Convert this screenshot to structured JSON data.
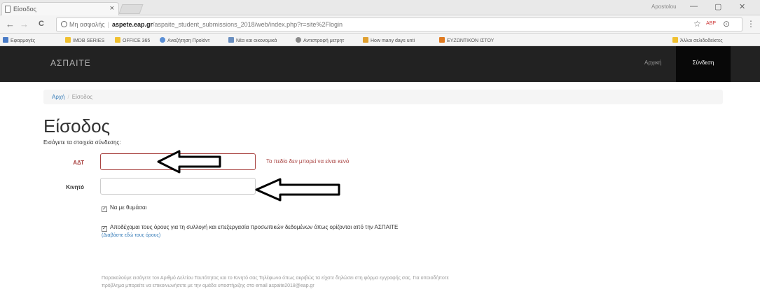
{
  "browser": {
    "tab_title": "Είσοδος",
    "tab_close": "×",
    "profile_name": "Apostolou",
    "window_controls": [
      "—",
      "▢",
      "✕"
    ],
    "nav": {
      "back": "←",
      "forward": "→",
      "reload": "C"
    },
    "address": {
      "security_label": "Μη ασφαλής",
      "host": "aspete.eap.gr",
      "path": "/aspaite_student_submissions_2018/web/index.php?r=site%2Flogin"
    },
    "toolbar_right": [
      "☆",
      "ABP",
      "⊙",
      "⋮"
    ],
    "bookmarks": [
      {
        "label": "Εφαρμογές",
        "color": "#4a7cc7"
      },
      {
        "label": "IMDB SERIES",
        "color": "#f0c030"
      },
      {
        "label": "OFFICE 365",
        "color": "#f0c030"
      },
      {
        "label": "Αναζήτηση Προϊόντ",
        "color": "#5b8fd6"
      },
      {
        "label": "Νέα και οικονομικά",
        "color": "#6a8fc0"
      },
      {
        "label": "Αντιστροφή μετρητ",
        "color": "#8a8a8a"
      },
      {
        "label": "How many days unti",
        "color": "#e0a030"
      },
      {
        "label": "ΕΥΖΩΝΤΙΚΟΝ ΙΣΤΟΥ",
        "color": "#e07a20"
      }
    ],
    "other_bookmarks": "Άλλοι σελιδοδείκτες"
  },
  "site": {
    "brand": "ΑΣΠΑΙΤΕ",
    "nav_home": "Αρχική",
    "nav_login": "Σύνδεση"
  },
  "breadcrumb": {
    "home": "Αρχή",
    "divider": "/",
    "current": "Είσοδος"
  },
  "page": {
    "title": "Είσοδος",
    "intro": "Εισάγετε τα στοιχεία σύνδεσης:",
    "fields": {
      "adt_label": "ΑΔΤ",
      "mobile_label": "Κινητό",
      "adt_error": "Το πεδίο δεν μπορεί να είναι κενό"
    },
    "remember_me": "Να με θυμάσαι",
    "terms_accept": "Αποδέχομαι τους όρους για τη συλλογή και επεξεργασία προσωπικών δεδομένων όπως ορίζονται από την ΑΣΠΑΙΤΕ",
    "terms_link": "(Διαβάστε εδώ τους όρους)",
    "note_line1": "Παρακαλούμε εισάγετε τον Αριθμό Δελτίου Ταυτότητας και το Κινητό σας Τηλέφωνο όπως ακριβώς τα είχατε δηλώσει στη φόρμα εγγραφής σας. Για οποιοδήποτε",
    "note_line2": "πρόβλημα μπορείτε να επικοινωνήσετε με την ομάδα υποστήριξης στο email aspaite2018@eap.gr",
    "check_mark": "✓"
  },
  "colors": {
    "error": "#a94442",
    "navbar": "#222222",
    "link": "#337ab7"
  }
}
